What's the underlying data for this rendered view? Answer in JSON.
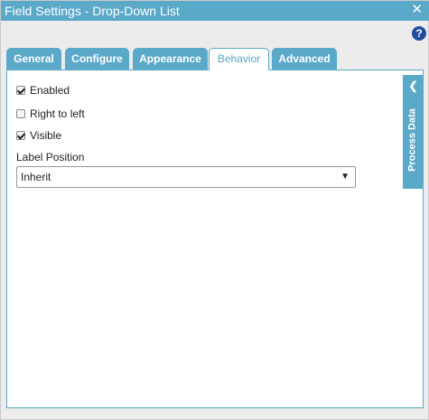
{
  "dialog": {
    "title": "Field Settings - Drop-Down List",
    "close_icon": "✕",
    "help_icon": "?"
  },
  "tabs": [
    {
      "label": "General",
      "active": false
    },
    {
      "label": "Configure",
      "active": false
    },
    {
      "label": "Appearance",
      "active": false
    },
    {
      "label": "Behavior",
      "active": true
    },
    {
      "label": "Advanced",
      "active": false
    }
  ],
  "behavior": {
    "options": [
      {
        "label": "Enabled",
        "checked": true
      },
      {
        "label": "Right to left",
        "checked": false
      },
      {
        "label": "Visible",
        "checked": true
      }
    ],
    "label_position": {
      "label": "Label Position",
      "value": "Inherit",
      "arrow": "▼"
    }
  },
  "side_panel": {
    "label": "Process Data",
    "chevron": "❮"
  },
  "colors": {
    "accent": "#5aa9c9",
    "help": "#1f4e9e",
    "background": "#ececec"
  }
}
